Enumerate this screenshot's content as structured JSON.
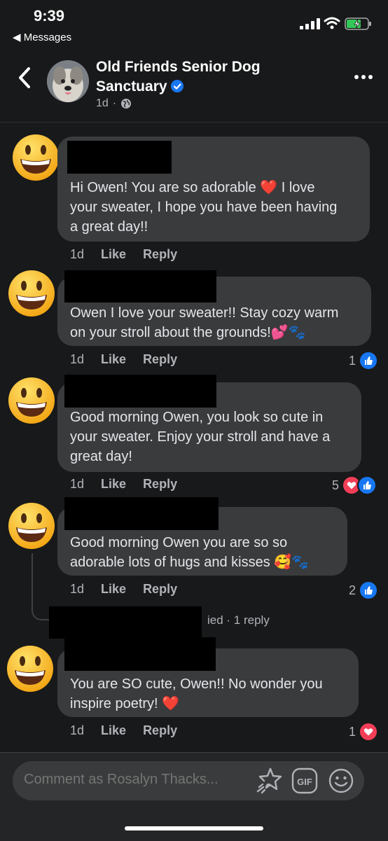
{
  "status_bar": {
    "time": "9:39",
    "back_app": "◀ Messages"
  },
  "header": {
    "page_name": "Old Friends Senior Dog Sanctuary",
    "timestamp": "1d",
    "separator": "·",
    "back_icon": "chevron-left-icon",
    "more_icon": "more-horizontal-icon",
    "privacy_icon": "globe-icon"
  },
  "colors": {
    "like_blue": "#1877f2",
    "love_red": "#f33e58",
    "bubble": "#3a3b3c",
    "background": "#18191a"
  },
  "comments": [
    {
      "lines": [
        "Hi Owen! You are so adorable ❤️  I love",
        "your sweater, I hope you have been having",
        "a great day!!"
      ],
      "time": "1d",
      "like": "Like",
      "reply": "Reply",
      "reaction_count": ""
    },
    {
      "lines": [
        "Owen I love your sweater!! Stay cozy warm",
        "on your stroll about the grounds!💕🐾"
      ],
      "time": "1d",
      "like": "Like",
      "reply": "Reply",
      "reaction_count": "1"
    },
    {
      "lines": [
        "Good morning Owen, you look so cute in",
        "your sweater. Enjoy your stroll and have a",
        "great day!"
      ],
      "time": "1d",
      "like": "Like",
      "reply": "Reply",
      "reaction_count": "5"
    },
    {
      "lines": [
        "Good morning Owen you are so so",
        "adorable lots of hugs and kisses 🥰🐾"
      ],
      "time": "1d",
      "like": "Like",
      "reply": "Reply",
      "reaction_count": "2"
    },
    {
      "lines": [
        "You are SO cute, Owen!!  No wonder you",
        "inspire poetry! ❤️"
      ],
      "time": "1d",
      "like": "Like",
      "reply": "Reply",
      "reaction_count": "1"
    }
  ],
  "reply_summary": {
    "partial_text": "ied",
    "count_text": "· 1 reply"
  },
  "composer": {
    "placeholder": "Comment as Rosalyn Thacks...",
    "icons": [
      "sticker-icon",
      "gif-icon",
      "emoji-icon"
    ]
  }
}
